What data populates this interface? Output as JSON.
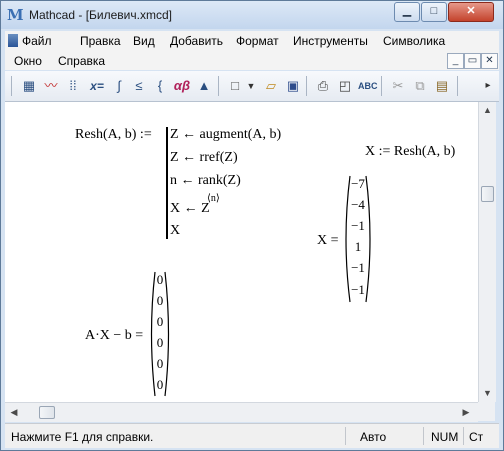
{
  "window": {
    "title": "Mathcad - [Билевич.xmcd]",
    "app_logo": "M",
    "min_icon": "▁",
    "max_icon": "□",
    "close_icon": "✕"
  },
  "menu": {
    "items": [
      "Файл",
      "Правка",
      "Вид",
      "Добавить",
      "Формат",
      "Инструменты",
      "Символика"
    ],
    "items2": [
      "Окно",
      "Справка"
    ],
    "mdi_min": "_",
    "mdi_restore": "▭",
    "mdi_close": "✕"
  },
  "toolbar": {
    "icons": [
      "calculator-icon",
      "graph-icon",
      "matrix-icon",
      "evaluate-icon",
      "calculus-icon",
      "boolean-icon",
      "programming-icon",
      "greek-icon",
      "symbolic-icon",
      "new-icon",
      "dropdown-icon",
      "open-icon",
      "save-icon",
      "print-icon",
      "print-preview-icon",
      "spell-check-icon",
      "cut-icon",
      "copy-icon",
      "paste-icon",
      "overflow-icon"
    ],
    "x_eq": "x=",
    "alpha_beta": "αβ"
  },
  "worksheet": {
    "resh_def": "Resh(A, b) :=",
    "program_lines": [
      "Z ← augment(A, b)",
      "Z ← rref(Z)",
      "n ← rank(Z)",
      "X ← Z",
      "X"
    ],
    "superscript": "⟨n⟩",
    "x_assign": "X := Resh(A, b)",
    "x_label": "X =",
    "x_values": [
      "−7",
      "−4",
      "−1",
      "1",
      "−1",
      "−1"
    ],
    "check_label": "A·X − b =",
    "check_values": [
      "0",
      "0",
      "0",
      "0",
      "0",
      "0"
    ]
  },
  "status": {
    "help": "Нажмите F1 для справки.",
    "mode": "Авто",
    "num": "NUM",
    "page": "Ст"
  }
}
